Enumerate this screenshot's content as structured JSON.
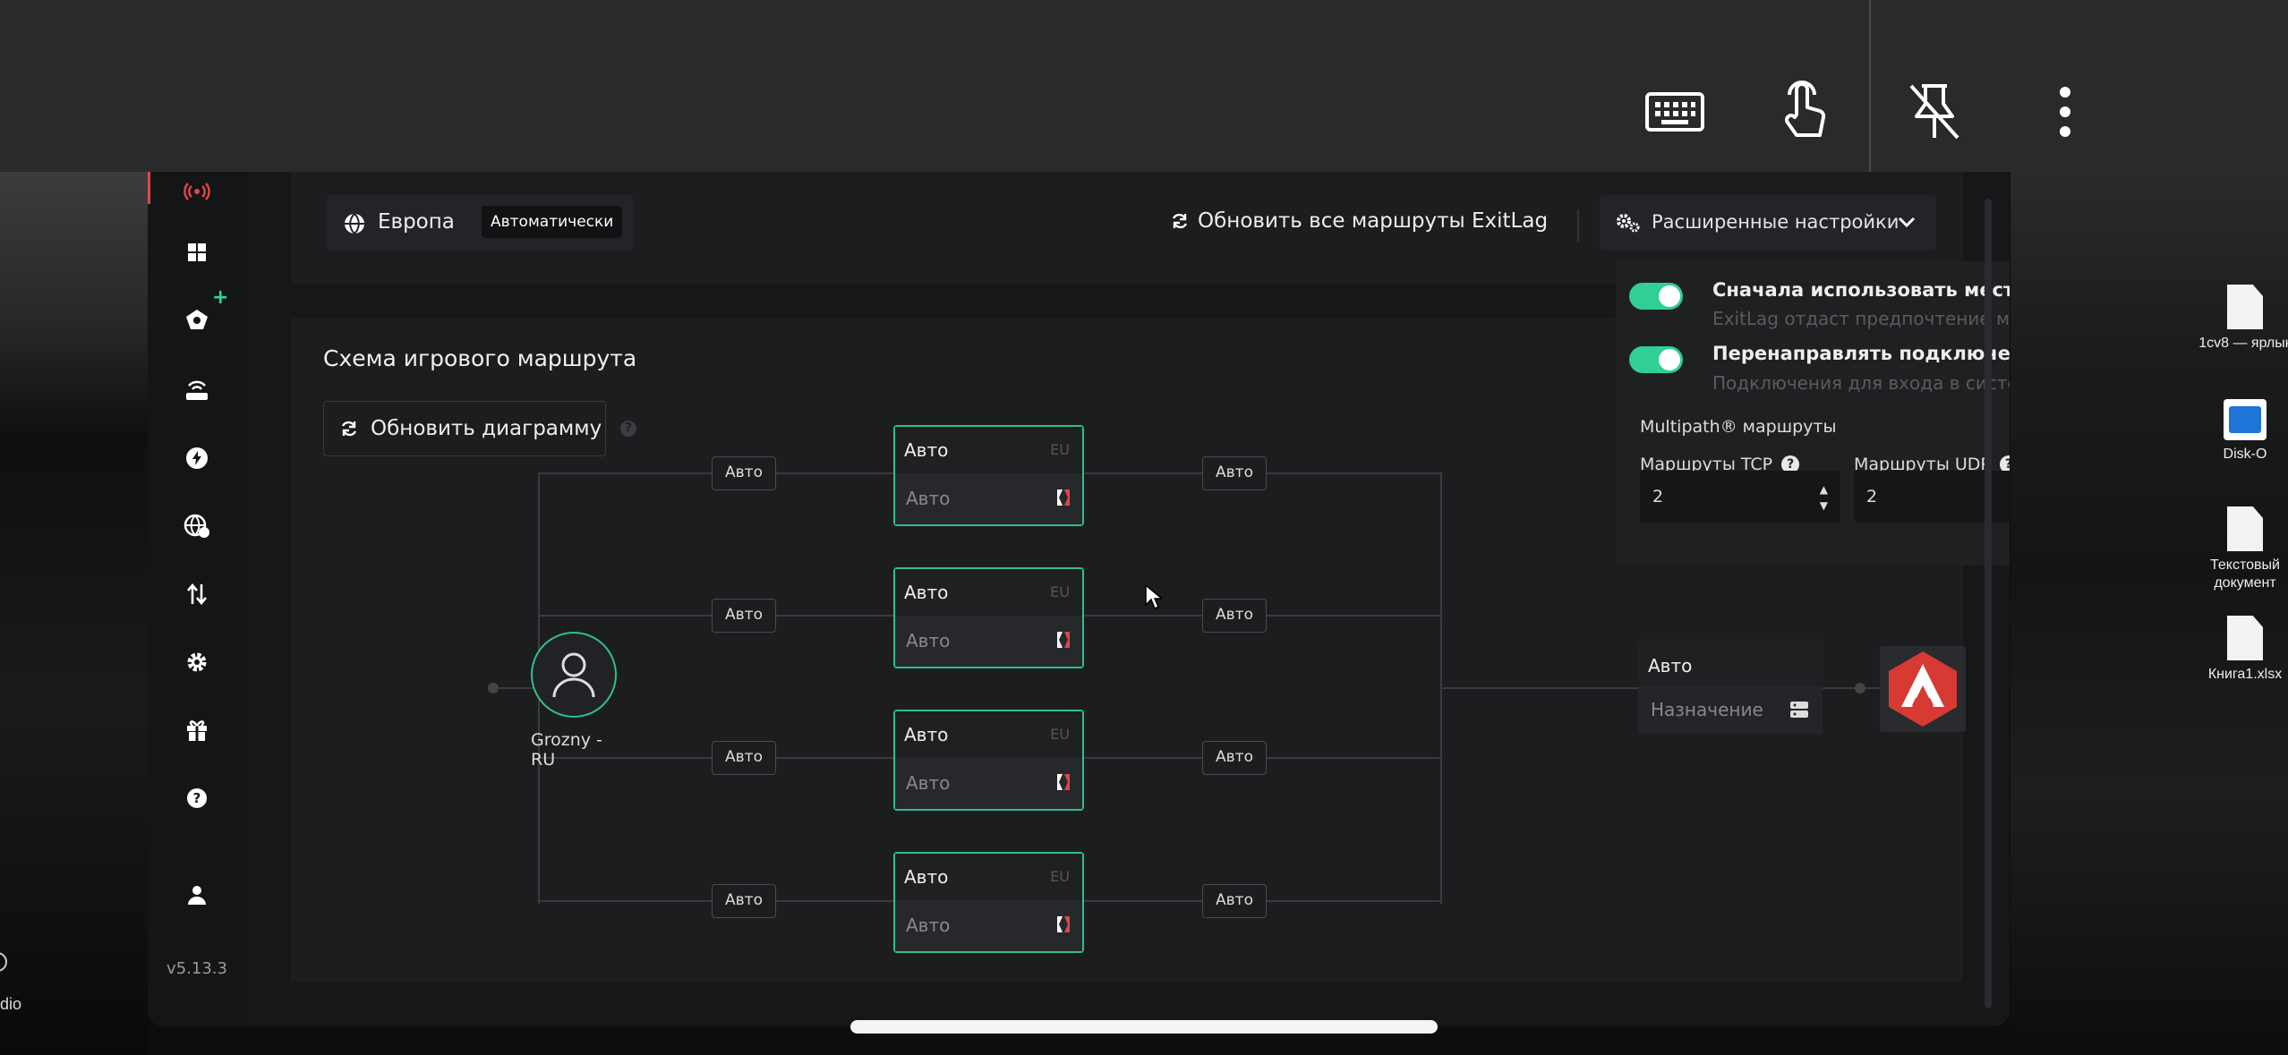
{
  "topbar": {
    "icons": [
      "keyboard-icon",
      "touch-icon",
      "unpin-icon",
      "more-icon"
    ]
  },
  "desktop": {
    "left_label": "dio",
    "right_icons": [
      "1cv8 — ярлык",
      "Disk-O",
      "Текстовый документ",
      "Книга1.xlsx"
    ]
  },
  "sidebar": {
    "version": "v5.13.3"
  },
  "region": {
    "name": "Европа",
    "mode": "Автоматически"
  },
  "header": {
    "refresh_all": "Обновить все маршруты ExitLag",
    "advanced": "Расширенные настройки"
  },
  "diagram": {
    "title": "Схема игрового маршрута",
    "refresh": "Обновить диаграмму",
    "user_label_1": "Grozny -",
    "user_label_2": "RU",
    "routes": [
      {
        "left": "Авто",
        "node_top": "Авто",
        "node_region": "EU",
        "node_bottom": "Авто",
        "right": "Авто"
      },
      {
        "left": "Авто",
        "node_top": "Авто",
        "node_region": "EU",
        "node_bottom": "Авто",
        "right": "Авто"
      },
      {
        "left": "Авто",
        "node_top": "Авто",
        "node_region": "EU",
        "node_bottom": "Авто",
        "right": "Авто"
      },
      {
        "left": "Авто",
        "node_top": "Авто",
        "node_region": "EU",
        "node_bottom": "Авто",
        "right": "Авто"
      }
    ],
    "dest_top": "Авто",
    "dest_bottom": "Назначение"
  },
  "dropdown": {
    "opt1_title": "Сначала использовать местные м...",
    "opt1_sub": "ExitLag отдаст предпочтение марш...",
    "opt2_title": "Перенаправлять подключения дл...",
    "opt2_sub": "Подключения для входа в систему ...",
    "multipath": "Multipath® маршруты",
    "tcp_label": "Маршруты TCP",
    "udp_label": "Маршруты UDP",
    "tcp_value": "2",
    "udp_value": "2"
  },
  "colors": {
    "accent": "#2fbf8a",
    "toggle": "#2fcf96",
    "alert": "#e24646"
  }
}
